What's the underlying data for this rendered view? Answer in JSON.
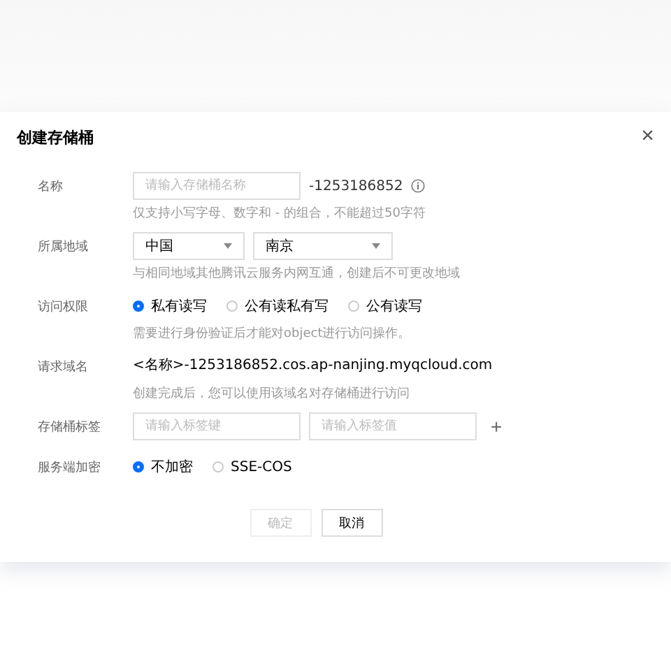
{
  "dialog": {
    "title": "创建存储桶",
    "close": "×"
  },
  "rows": [
    {
      "kind": "input",
      "label": "名称",
      "placeholder": "请输入存储桶名称",
      "suffix": "-1253186852",
      "hint": "仅支持小写字母、数字和 - 的组合，不能超过50字符"
    },
    {
      "kind": "selects",
      "label": "所属地域",
      "selects": [
        {
          "value": "中国"
        },
        {
          "value": "南京"
        }
      ],
      "hint": "与相同地域其他腾讯云服务内网互通，创建后不可更改地域"
    },
    {
      "kind": "radios",
      "label": "访问权限",
      "options": [
        {
          "label": "私有读写",
          "selected": true
        },
        {
          "label": "公有读私有写",
          "selected": false
        },
        {
          "label": "公有读写",
          "selected": false
        }
      ],
      "hint": "需要进行身份验证后才能对object进行访问操作。"
    },
    {
      "kind": "text",
      "label": "请求域名",
      "value": "<名称>-1253186852.cos.ap-nanjing.myqcloud.com",
      "hint": "创建完成后，您可以使用该域名对存储桶进行访问"
    },
    {
      "kind": "tags",
      "label": "存储桶标签",
      "inputs": [
        {
          "placeholder": "请输入标签键"
        },
        {
          "placeholder": "请输入标签值"
        }
      ],
      "add": "+"
    },
    {
      "kind": "radios",
      "label": "服务端加密",
      "options": [
        {
          "label": "不加密",
          "selected": true
        },
        {
          "label": "SSE-COS",
          "selected": false
        }
      ]
    }
  ],
  "buttons": [
    {
      "label": "确定",
      "disabled": true
    },
    {
      "label": "取消",
      "disabled": false
    }
  ]
}
